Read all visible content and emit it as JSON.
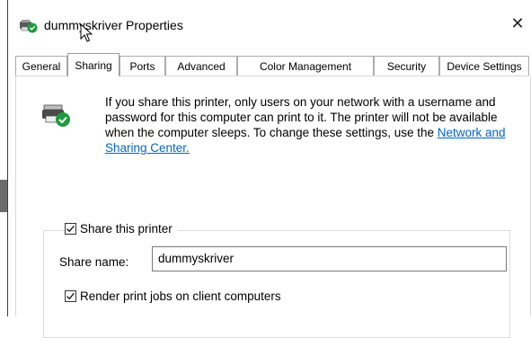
{
  "window": {
    "title": "dummyskriver Properties",
    "close_glyph": "✕",
    "icon": "printer-icon"
  },
  "tabs": [
    {
      "label": "General",
      "active": false
    },
    {
      "label": "Sharing",
      "active": true
    },
    {
      "label": "Ports",
      "active": false
    },
    {
      "label": "Advanced",
      "active": false
    },
    {
      "label": "Color Management",
      "active": false
    },
    {
      "label": "Security",
      "active": false
    },
    {
      "label": "Device Settings",
      "active": false
    }
  ],
  "sharing": {
    "info_text": "If you share this printer, only users on your network with a username and password for this computer can print to it. The printer will not be available when the computer sleeps. To change these settings, use the",
    "info_link": "Network and Sharing Center.",
    "share_printer_label": "Share this printer",
    "share_printer_checked": true,
    "share_name_label": "Share name:",
    "share_name_value": "dummyskriver",
    "render_jobs_label": "Render print jobs on client computers",
    "render_jobs_checked": true
  },
  "colors": {
    "link": "#0066cc",
    "badge_green": "#1e9b3c"
  }
}
